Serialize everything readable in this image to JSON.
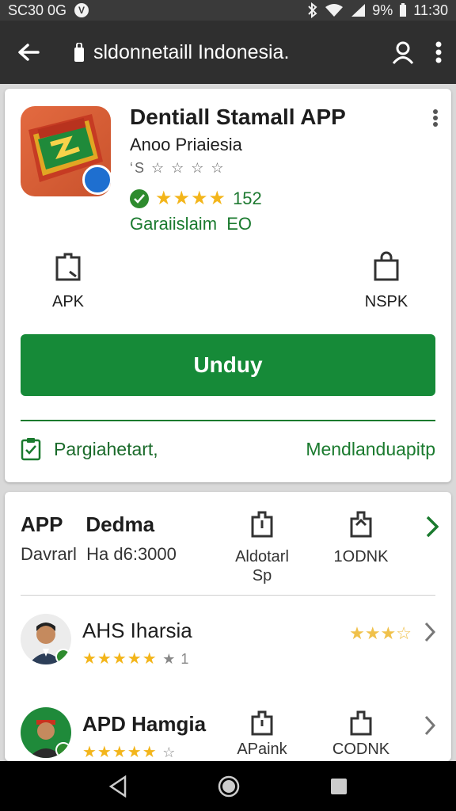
{
  "status_bar": {
    "time_left": "SC30 0G",
    "badge": "V",
    "battery": "9%",
    "time_right": "11:30"
  },
  "app_bar": {
    "title": "sldonnetaill Indonesia."
  },
  "app": {
    "name": "Dentiall Stamall APP",
    "developer": "Anoo Priaiesia",
    "rating_line": "‘S ☆ ☆ ☆ ☆",
    "stars": "★★★★",
    "rating_count": "152",
    "category": "Garaiislaim  EO"
  },
  "downloads": {
    "apk_label": "APK",
    "xapk_label": "NSPK"
  },
  "install_button": "Unduy",
  "permissions": {
    "left": "Pargiahetart,",
    "right": "Mendlanduapitp"
  },
  "section": {
    "heading": "APP    Dedma",
    "sub": "Davrarl  Ha d6:3000",
    "col1_label": "Aldotarl\nSp",
    "col2_label": "1ODNK"
  },
  "list": [
    {
      "name": "AHS Iharsia",
      "stars": "★★★★★",
      "extra": "★ 1",
      "right_stars": "★★★☆"
    },
    {
      "name": "APD Hamgia",
      "stars": "★★★★★",
      "extra": "☆",
      "col1_label": "APaink",
      "col2_label": "CODNK"
    }
  ],
  "colors": {
    "primary_green": "#168a38",
    "text_green": "#1a7a2e",
    "star_yellow": "#f3b51a",
    "app_bar": "#2f2f2f"
  }
}
